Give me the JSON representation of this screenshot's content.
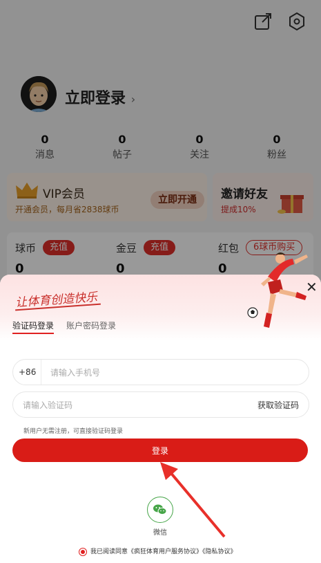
{
  "profile": {
    "login_title": "立即登录",
    "login_chevron": "›",
    "stats": [
      {
        "num": "0",
        "label": "消息"
      },
      {
        "num": "0",
        "label": "帖子"
      },
      {
        "num": "0",
        "label": "关注"
      },
      {
        "num": "0",
        "label": "粉丝"
      }
    ],
    "vip": {
      "title": "VIP会员",
      "subtitle": "开通会员，每月省2838球币",
      "button": "立即开通"
    },
    "invite": {
      "title": "邀请好友",
      "subtitle": "提成10%"
    },
    "wallet": [
      {
        "label": "球币",
        "button": "充值",
        "value": "0"
      },
      {
        "label": "金豆",
        "button": "充值",
        "value": "0"
      },
      {
        "label": "红包",
        "button": "6球币购买",
        "value": "0"
      }
    ],
    "icons": {
      "share": "share-icon",
      "settings": "settings-icon"
    }
  },
  "login_sheet": {
    "slogan": "让体育创造快乐",
    "tabs": {
      "sms": "验证码登录",
      "password": "账户密码登录"
    },
    "close": "✕",
    "phone": {
      "country_code": "+86",
      "placeholder": "请输入手机号"
    },
    "code": {
      "placeholder": "请输入验证码",
      "get_code": "获取验证码"
    },
    "note": "新用户无需注册，可直接验证码登录",
    "login_button": "登录",
    "wechat_label": "微信",
    "agreement": "我已阅读同意《疯狂体育用户服务协议》《隐私协议》"
  },
  "colors": {
    "accent": "#d91c17",
    "wechat": "#46a548"
  }
}
